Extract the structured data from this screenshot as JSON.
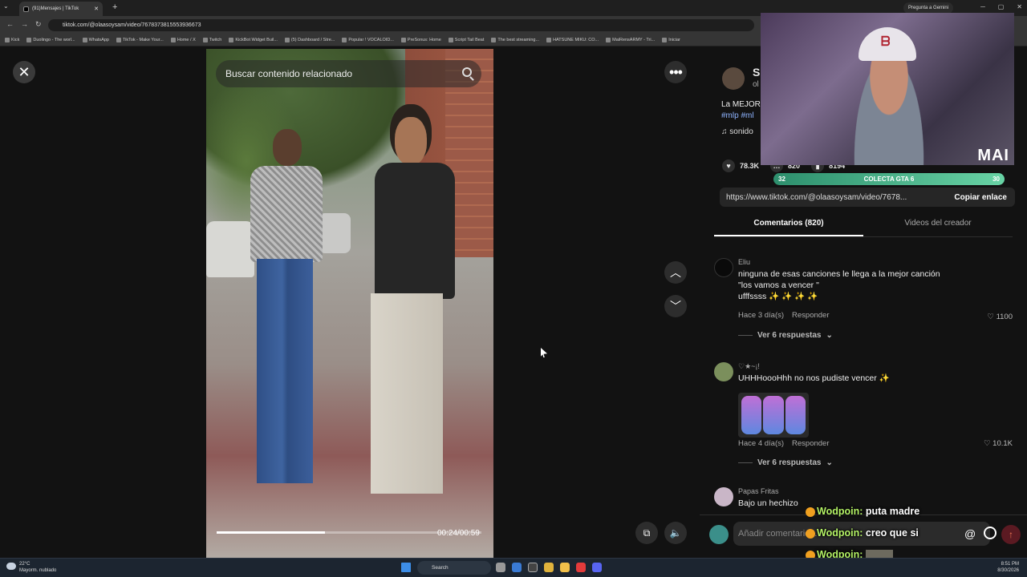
{
  "browser": {
    "tab_title": "(91)Mensajes | TikTok",
    "url": "tiktok.com/@olaasoysam/video/7678373815553936673",
    "gemini_label": "Pregunta a Gemini",
    "bookmarks": [
      "Kick",
      "Duolingo - The worl...",
      "WhatsApp",
      "TikTok - Make Your...",
      "Home / X",
      "Twitch",
      "KickBot Widget Buil...",
      "(5) Dashboard / Stre...",
      "Popular ! VOCALOID...",
      "PreSonus: Home",
      "Script Tail Beat",
      "The best streaming...",
      "HATSUNE MIKU: CO...",
      "MaiRensARMY - Tri...",
      "Iniciar"
    ]
  },
  "video": {
    "search_placeholder": "Buscar contenido relacionado",
    "time": "00:24/00:59",
    "progress_fraction": 0.41
  },
  "author": {
    "name": "S",
    "id": "ol",
    "caption": "La MEJOR",
    "tags": "#mlp #ml",
    "sound": "sonido"
  },
  "stats": {
    "likes": "78.3K",
    "comments": "820",
    "saves": "8194"
  },
  "link": {
    "url": "https://www.tiktok.com/@olaasoysam/video/7678...",
    "copy_label": "Copiar enlace"
  },
  "tabs": {
    "comments": "Comentarios (820)",
    "creator_videos": "Videos del creador"
  },
  "comments": [
    {
      "user": "Eliu",
      "lines": [
        "ninguna de esas canciones le llega a la mejor canción",
        "\"los vamos a vencer \"",
        "ufffssss ✨ ✨ ✨ ✨"
      ],
      "time": "Hace 3 día(s)",
      "reply": "Responder",
      "likes": "1100",
      "more": "Ver 6 respuestas"
    },
    {
      "user": "♡★~¡!",
      "lines": [
        "UHHHoooHhh no nos pudiste vencer ✨"
      ],
      "time": "Hace 4 día(s)",
      "reply": "Responder",
      "likes": "10.1K",
      "more": "Ver 6 respuestas"
    },
    {
      "user": "Papas Fritas",
      "lines": [
        "Bajo un hechizo"
      ]
    }
  ],
  "comment_input": {
    "placeholder": "Añadir comentario...",
    "at": "@",
    "send_icon": "arrow-up-icon"
  },
  "stream": {
    "cam_label": "MAI",
    "goal_left": "32",
    "goal_title": "COLECTA GTA 6",
    "goal_right": "30",
    "chat": [
      {
        "user": "Wodpoin:",
        "msg": "puta madre"
      },
      {
        "user": "Wodpoin:",
        "msg": "creo que si"
      },
      {
        "user": "Wodpoin:",
        "msg": ""
      }
    ]
  },
  "taskbar": {
    "temp": "22°C",
    "weather": "Mayorm. nublado",
    "search": "Search",
    "time": "8:51 PM",
    "date": "8/30/2026"
  }
}
